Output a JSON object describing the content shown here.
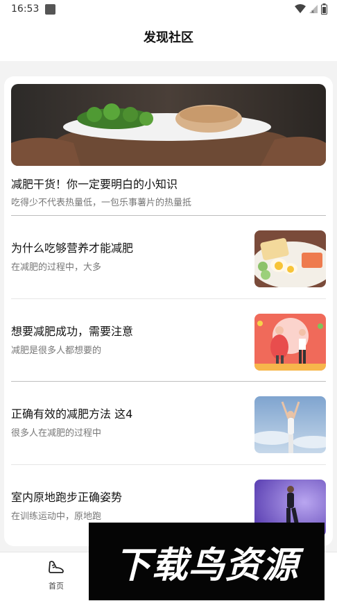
{
  "status_bar": {
    "time": "16:53"
  },
  "header": {
    "title": "发现社区"
  },
  "featured": {
    "title": "减肥干货！你一定要明白的小知识",
    "subtitle": "吃得少不代表热量低，一包乐事薯片的热量抵",
    "image": "plate-of-broccoli-and-chicken"
  },
  "articles": [
    {
      "title": "为什么吃够营养才能减肥",
      "subtitle": "在减肥的过程中，大多",
      "image": "bread-egg-salmon-plate"
    },
    {
      "title": "想要减肥成功，需要注意",
      "subtitle": "减肥是很多人都想要的",
      "image": "before-after-weightloss-illustration"
    },
    {
      "title": "正确有效的减肥方法 这4",
      "subtitle": "很多人在减肥的过程中",
      "image": "woman-exercising-sky"
    },
    {
      "title": "室内原地跑步正确姿势",
      "subtitle": "在训练运动中，原地跑",
      "image": "woman-running-purple-bg"
    }
  ],
  "tabbar": {
    "tabs": [
      {
        "label": "首页",
        "icon": "sneaker-icon"
      }
    ]
  },
  "watermark": {
    "text": "下载鸟资源"
  },
  "colors": {
    "accent": "#111111",
    "subtitle": "#777777",
    "background": "#f3f3f3"
  }
}
